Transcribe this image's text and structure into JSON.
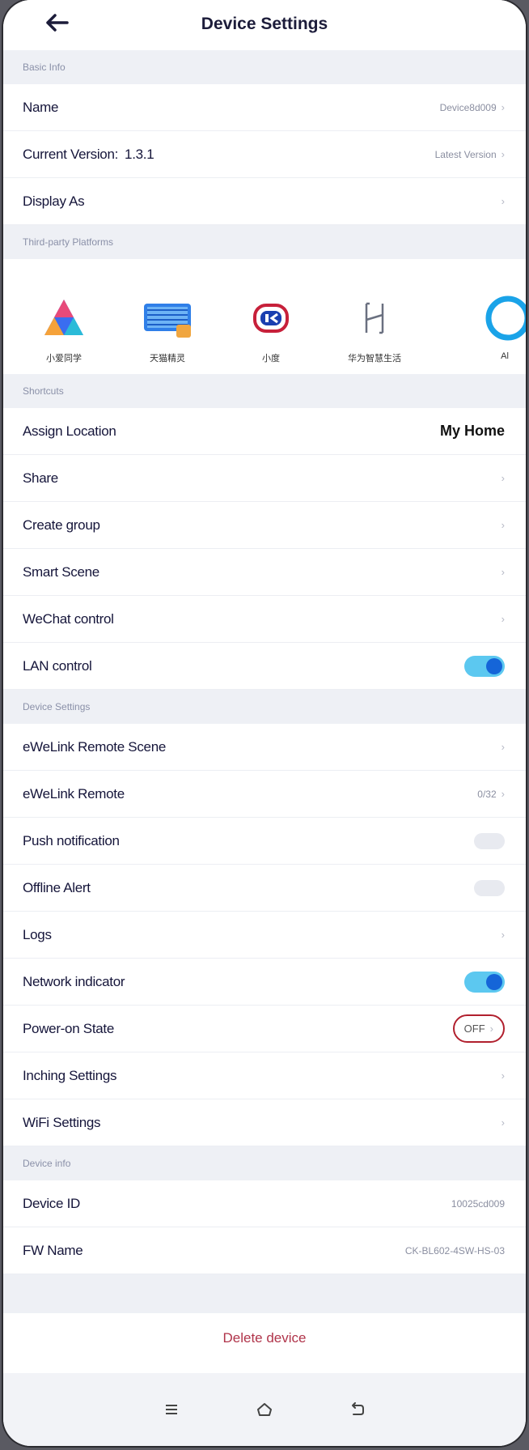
{
  "header": {
    "title": "Device Settings"
  },
  "basic_info": {
    "section": "Basic Info",
    "name_label": "Name",
    "name_value": "Device8d009",
    "version_label": "Current Version:",
    "version_number": "1.3.1",
    "version_value": "Latest Version",
    "display_label": "Display As"
  },
  "third_party": {
    "section": "Third-party Platforms",
    "platforms": [
      {
        "label": "小爱同学",
        "icon": "xiaoai-icon"
      },
      {
        "label": "天猫精灵",
        "icon": "tmall-genie-icon"
      },
      {
        "label": "小度",
        "icon": "xiaodu-icon"
      },
      {
        "label": "华为智慧生活",
        "icon": "huawei-smart-life-icon"
      },
      {
        "label": "Al",
        "icon": "alexa-icon"
      }
    ]
  },
  "shortcuts": {
    "section": "Shortcuts",
    "assign_location_label": "Assign Location",
    "assign_location_value": "My Home",
    "share_label": "Share",
    "create_group_label": "Create group",
    "smart_scene_label": "Smart Scene",
    "wechat_label": "WeChat control",
    "lan_label": "LAN control"
  },
  "device_settings": {
    "section": "Device Settings",
    "remote_scene_label": "eWeLink Remote Scene",
    "remote_label": "eWeLink Remote",
    "remote_value": "0/32",
    "push_label": "Push notification",
    "offline_label": "Offline Alert",
    "logs_label": "Logs",
    "network_label": "Network indicator",
    "power_on_label": "Power-on State",
    "power_on_value": "OFF",
    "inching_label": "Inching Settings",
    "wifi_label": "WiFi Settings"
  },
  "device_info": {
    "section": "Device info",
    "id_label": "Device ID",
    "id_value": "10025cd009",
    "fw_label": "FW Name",
    "fw_value": "CK-BL602-4SW-HS-03"
  },
  "actions": {
    "delete_label": "Delete device"
  },
  "colors": {
    "accent": "#1565d8",
    "toggle_track": "#5cc8f0",
    "danger": "#b0344a",
    "highlight_ring": "#b1202e"
  }
}
